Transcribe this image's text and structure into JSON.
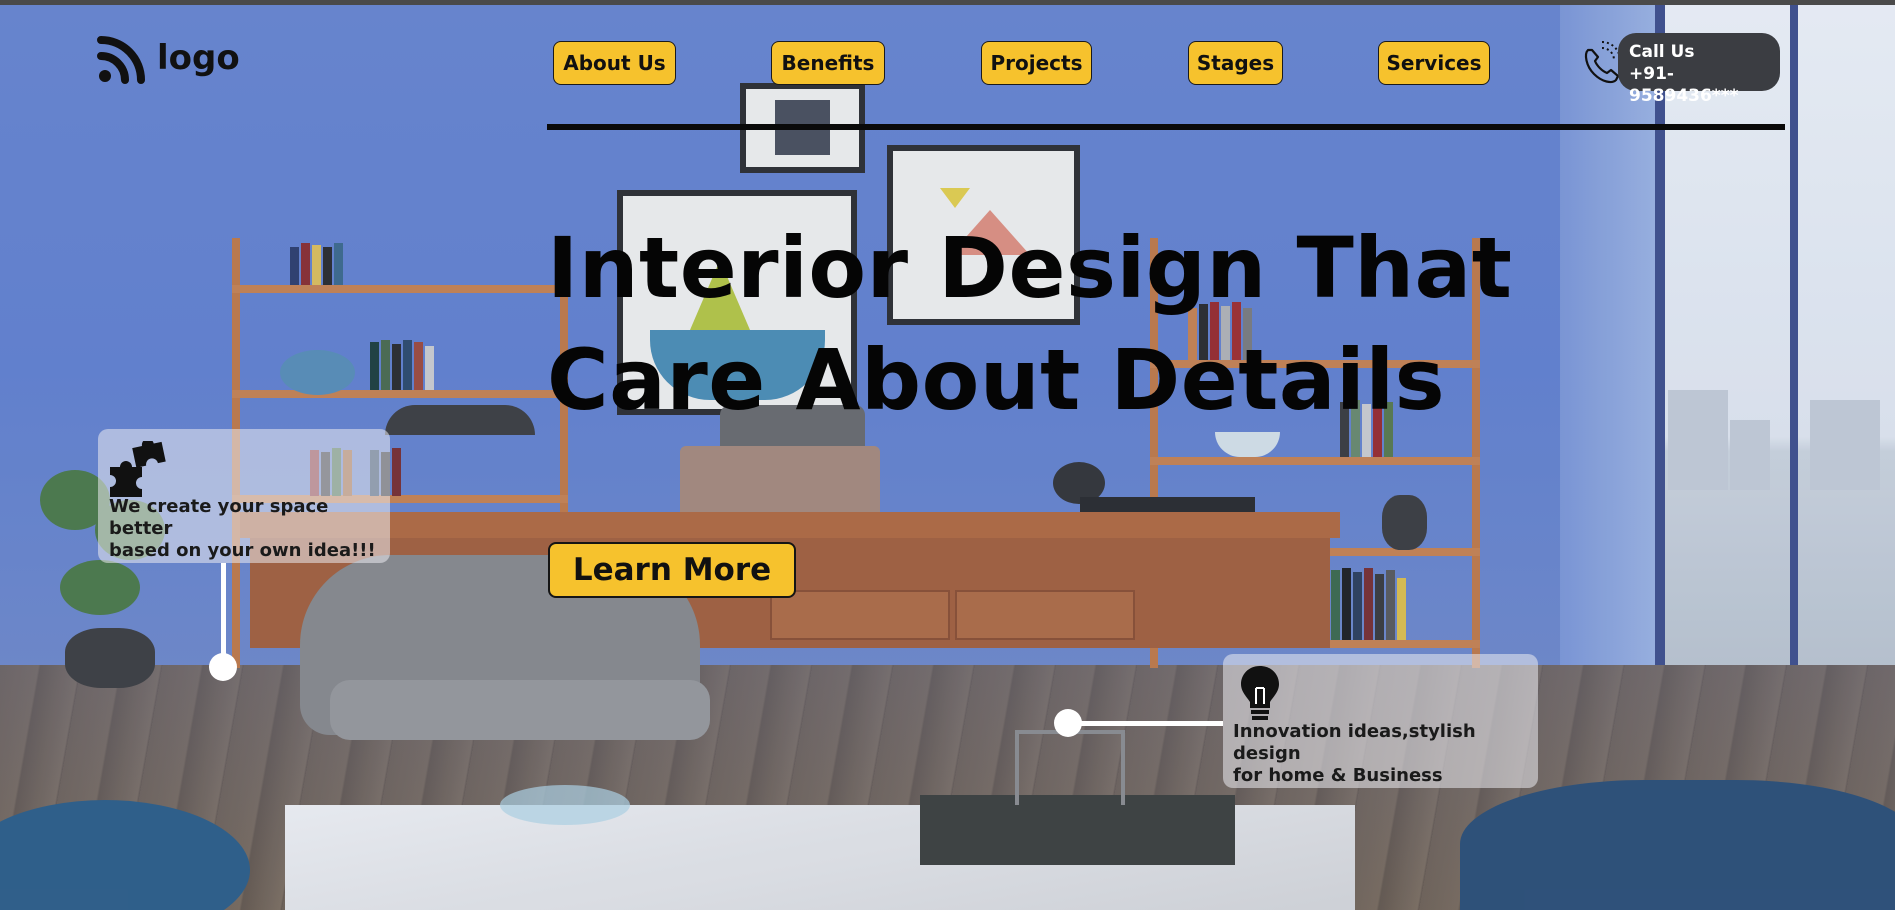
{
  "logo": {
    "text": "logo",
    "icon": "rss-wave-icon"
  },
  "nav": {
    "items": [
      {
        "label": "About Us"
      },
      {
        "label": "Benefits"
      },
      {
        "label": "Projects"
      },
      {
        "label": "Stages"
      },
      {
        "label": "Services"
      }
    ]
  },
  "contact": {
    "icon": "phone-icon",
    "title": "Call Us",
    "phone": "+91-9589436***"
  },
  "hero": {
    "line1": "Interior Design That",
    "line2": "Care About Details"
  },
  "cta": {
    "label": "Learn More"
  },
  "features": [
    {
      "icon": "puzzle-icon",
      "text_line1": "We create your space better",
      "text_line2": "based on your own idea!!!"
    },
    {
      "icon": "lightbulb-icon",
      "text_line1": "Innovation ideas,stylish design",
      "text_line2": "for home & Business"
    }
  ],
  "colors": {
    "accent": "#f6c22d",
    "pill": "#3b3d42",
    "text": "#111111"
  }
}
